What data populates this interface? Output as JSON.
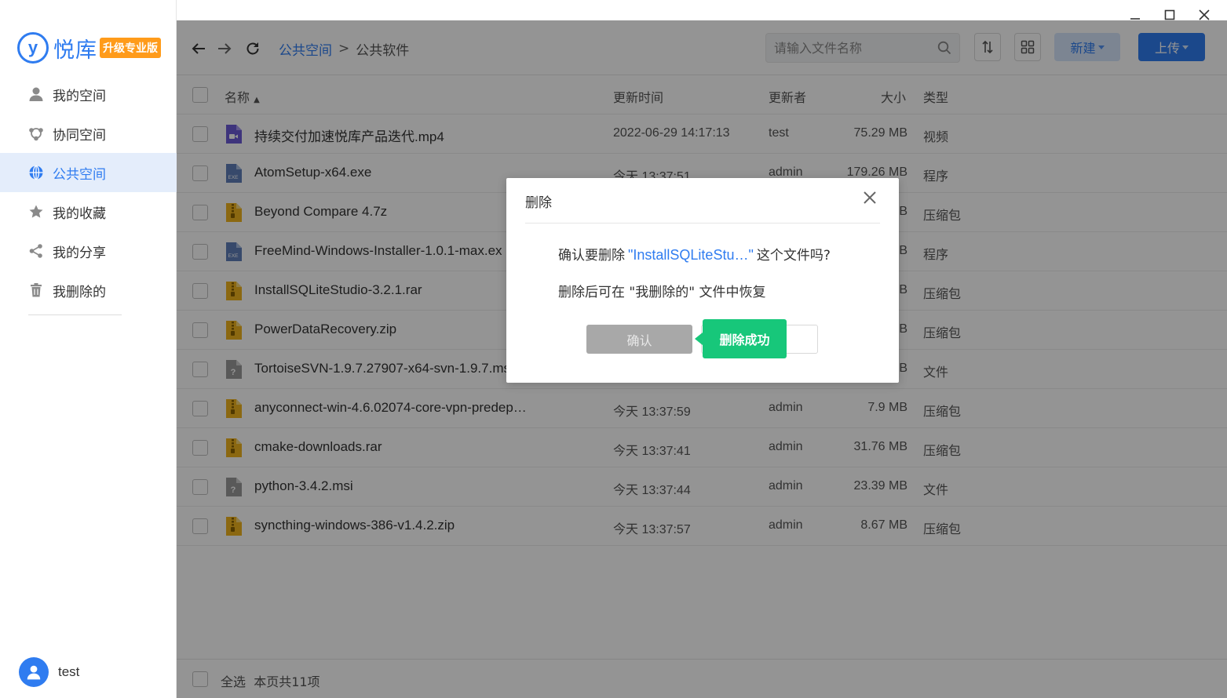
{
  "brand": {
    "logo_letter": "y",
    "name": "悦库",
    "badge": "升级专业版",
    "color": "#2f7cf0"
  },
  "sidebar": {
    "items": [
      {
        "label": "我的空间",
        "icon": "user-icon",
        "active": false
      },
      {
        "label": "协同空间",
        "icon": "collaborate-icon",
        "active": false
      },
      {
        "label": "公共空间",
        "icon": "globe-icon",
        "active": true
      },
      {
        "label": "我的收藏",
        "icon": "star-icon",
        "active": false
      },
      {
        "label": "我的分享",
        "icon": "share-icon",
        "active": false
      },
      {
        "label": "我删除的",
        "icon": "trash-icon",
        "active": false
      }
    ]
  },
  "user": {
    "name": "test"
  },
  "breadcrumb": {
    "root": "公共空间",
    "separator": ">",
    "current": "公共软件"
  },
  "search": {
    "placeholder": "请输入文件名称"
  },
  "toolbar": {
    "new_label": "新建",
    "upload_label": "上传"
  },
  "table": {
    "headers": {
      "name": "名称",
      "time": "更新时间",
      "user": "更新者",
      "size": "大小",
      "type": "类型"
    },
    "rows": [
      {
        "name": "持续交付加速悦库产品迭代.mp4",
        "time": "2022-06-29 14:17:13",
        "user": "test",
        "size": "75.29 MB",
        "type": "视频",
        "icon": "video-file-icon"
      },
      {
        "name": "AtomSetup-x64.exe",
        "time": "今天 13:37:51",
        "user": "admin",
        "size": "179.26 MB",
        "type": "程序",
        "icon": "exe-file-icon"
      },
      {
        "name": "Beyond Compare 4.7z",
        "time": "",
        "user": "",
        "size": "B",
        "type": "压缩包",
        "icon": "zip-file-icon"
      },
      {
        "name": "FreeMind-Windows-Installer-1.0.1-max.ex",
        "time": "",
        "user": "",
        "size": "B",
        "type": "程序",
        "icon": "exe-file-icon"
      },
      {
        "name": "InstallSQLiteStudio-3.2.1.rar",
        "time": "",
        "user": "",
        "size": "B",
        "type": "压缩包",
        "icon": "zip-file-icon"
      },
      {
        "name": "PowerDataRecovery.zip",
        "time": "",
        "user": "",
        "size": "B",
        "type": "压缩包",
        "icon": "zip-file-icon"
      },
      {
        "name": "TortoiseSVN-1.9.7.27907-x64-svn-1.9.7.ms",
        "time": "",
        "user": "",
        "size": "B",
        "type": "文件",
        "icon": "unknown-file-icon"
      },
      {
        "name": "anyconnect-win-4.6.02074-core-vpn-predep…",
        "time": "今天 13:37:59",
        "user": "admin",
        "size": "7.9 MB",
        "type": "压缩包",
        "icon": "zip-file-icon"
      },
      {
        "name": "cmake-downloads.rar",
        "time": "今天 13:37:41",
        "user": "admin",
        "size": "31.76 MB",
        "type": "压缩包",
        "icon": "zip-file-icon"
      },
      {
        "name": "python-3.4.2.msi",
        "time": "今天 13:37:44",
        "user": "admin",
        "size": "23.39 MB",
        "type": "文件",
        "icon": "unknown-file-icon"
      },
      {
        "name": "syncthing-windows-386-v1.4.2.zip",
        "time": "今天 13:37:57",
        "user": "admin",
        "size": "8.67 MB",
        "type": "压缩包",
        "icon": "zip-file-icon"
      }
    ]
  },
  "footer": {
    "select_all": "全选",
    "page_count": "本页共11项"
  },
  "dialog": {
    "title": "删除",
    "msg_prefix": "确认要删除",
    "quote_open": "\"",
    "file": "InstallSQLiteStu…",
    "quote_close": "\"",
    "msg_suffix": "这个文件吗?",
    "note": "删除后可在 \"我删除的\" 文件中恢复",
    "confirm_label": "确认"
  },
  "toast": {
    "text": "删除成功",
    "color": "#17c77a"
  }
}
